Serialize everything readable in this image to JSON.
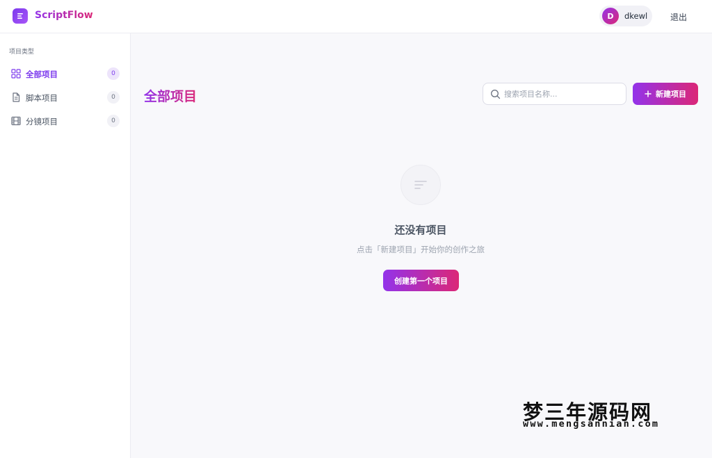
{
  "header": {
    "app_name": "ScriptFlow",
    "logo_icon": "document-lines-icon",
    "user": {
      "avatar_letter": "D",
      "name": "dkewl"
    },
    "logout_label": "退出"
  },
  "sidebar": {
    "section_title": "项目类型",
    "items": [
      {
        "label": "全部项目",
        "count": "0",
        "icon": "grid-icon",
        "active": true
      },
      {
        "label": "脚本项目",
        "count": "0",
        "icon": "document-icon",
        "active": false
      },
      {
        "label": "分镜项目",
        "count": "0",
        "icon": "film-icon",
        "active": false
      }
    ]
  },
  "main": {
    "title": "全部项目",
    "search": {
      "placeholder": "搜索项目名称...",
      "value": ""
    },
    "new_button_label": "新建项目",
    "empty": {
      "icon": "sort-lines-icon",
      "title": "还没有项目",
      "subtitle": "点击「新建项目」开始你的创作之旅",
      "button_label": "创建第一个项目"
    }
  },
  "watermark": {
    "text_cn": "梦三年源码网",
    "text_en": "www.mengsannian.com"
  },
  "colors": {
    "accent": "#7c3aed",
    "gradient_start": "#9333ea",
    "gradient_end": "#db2777"
  }
}
